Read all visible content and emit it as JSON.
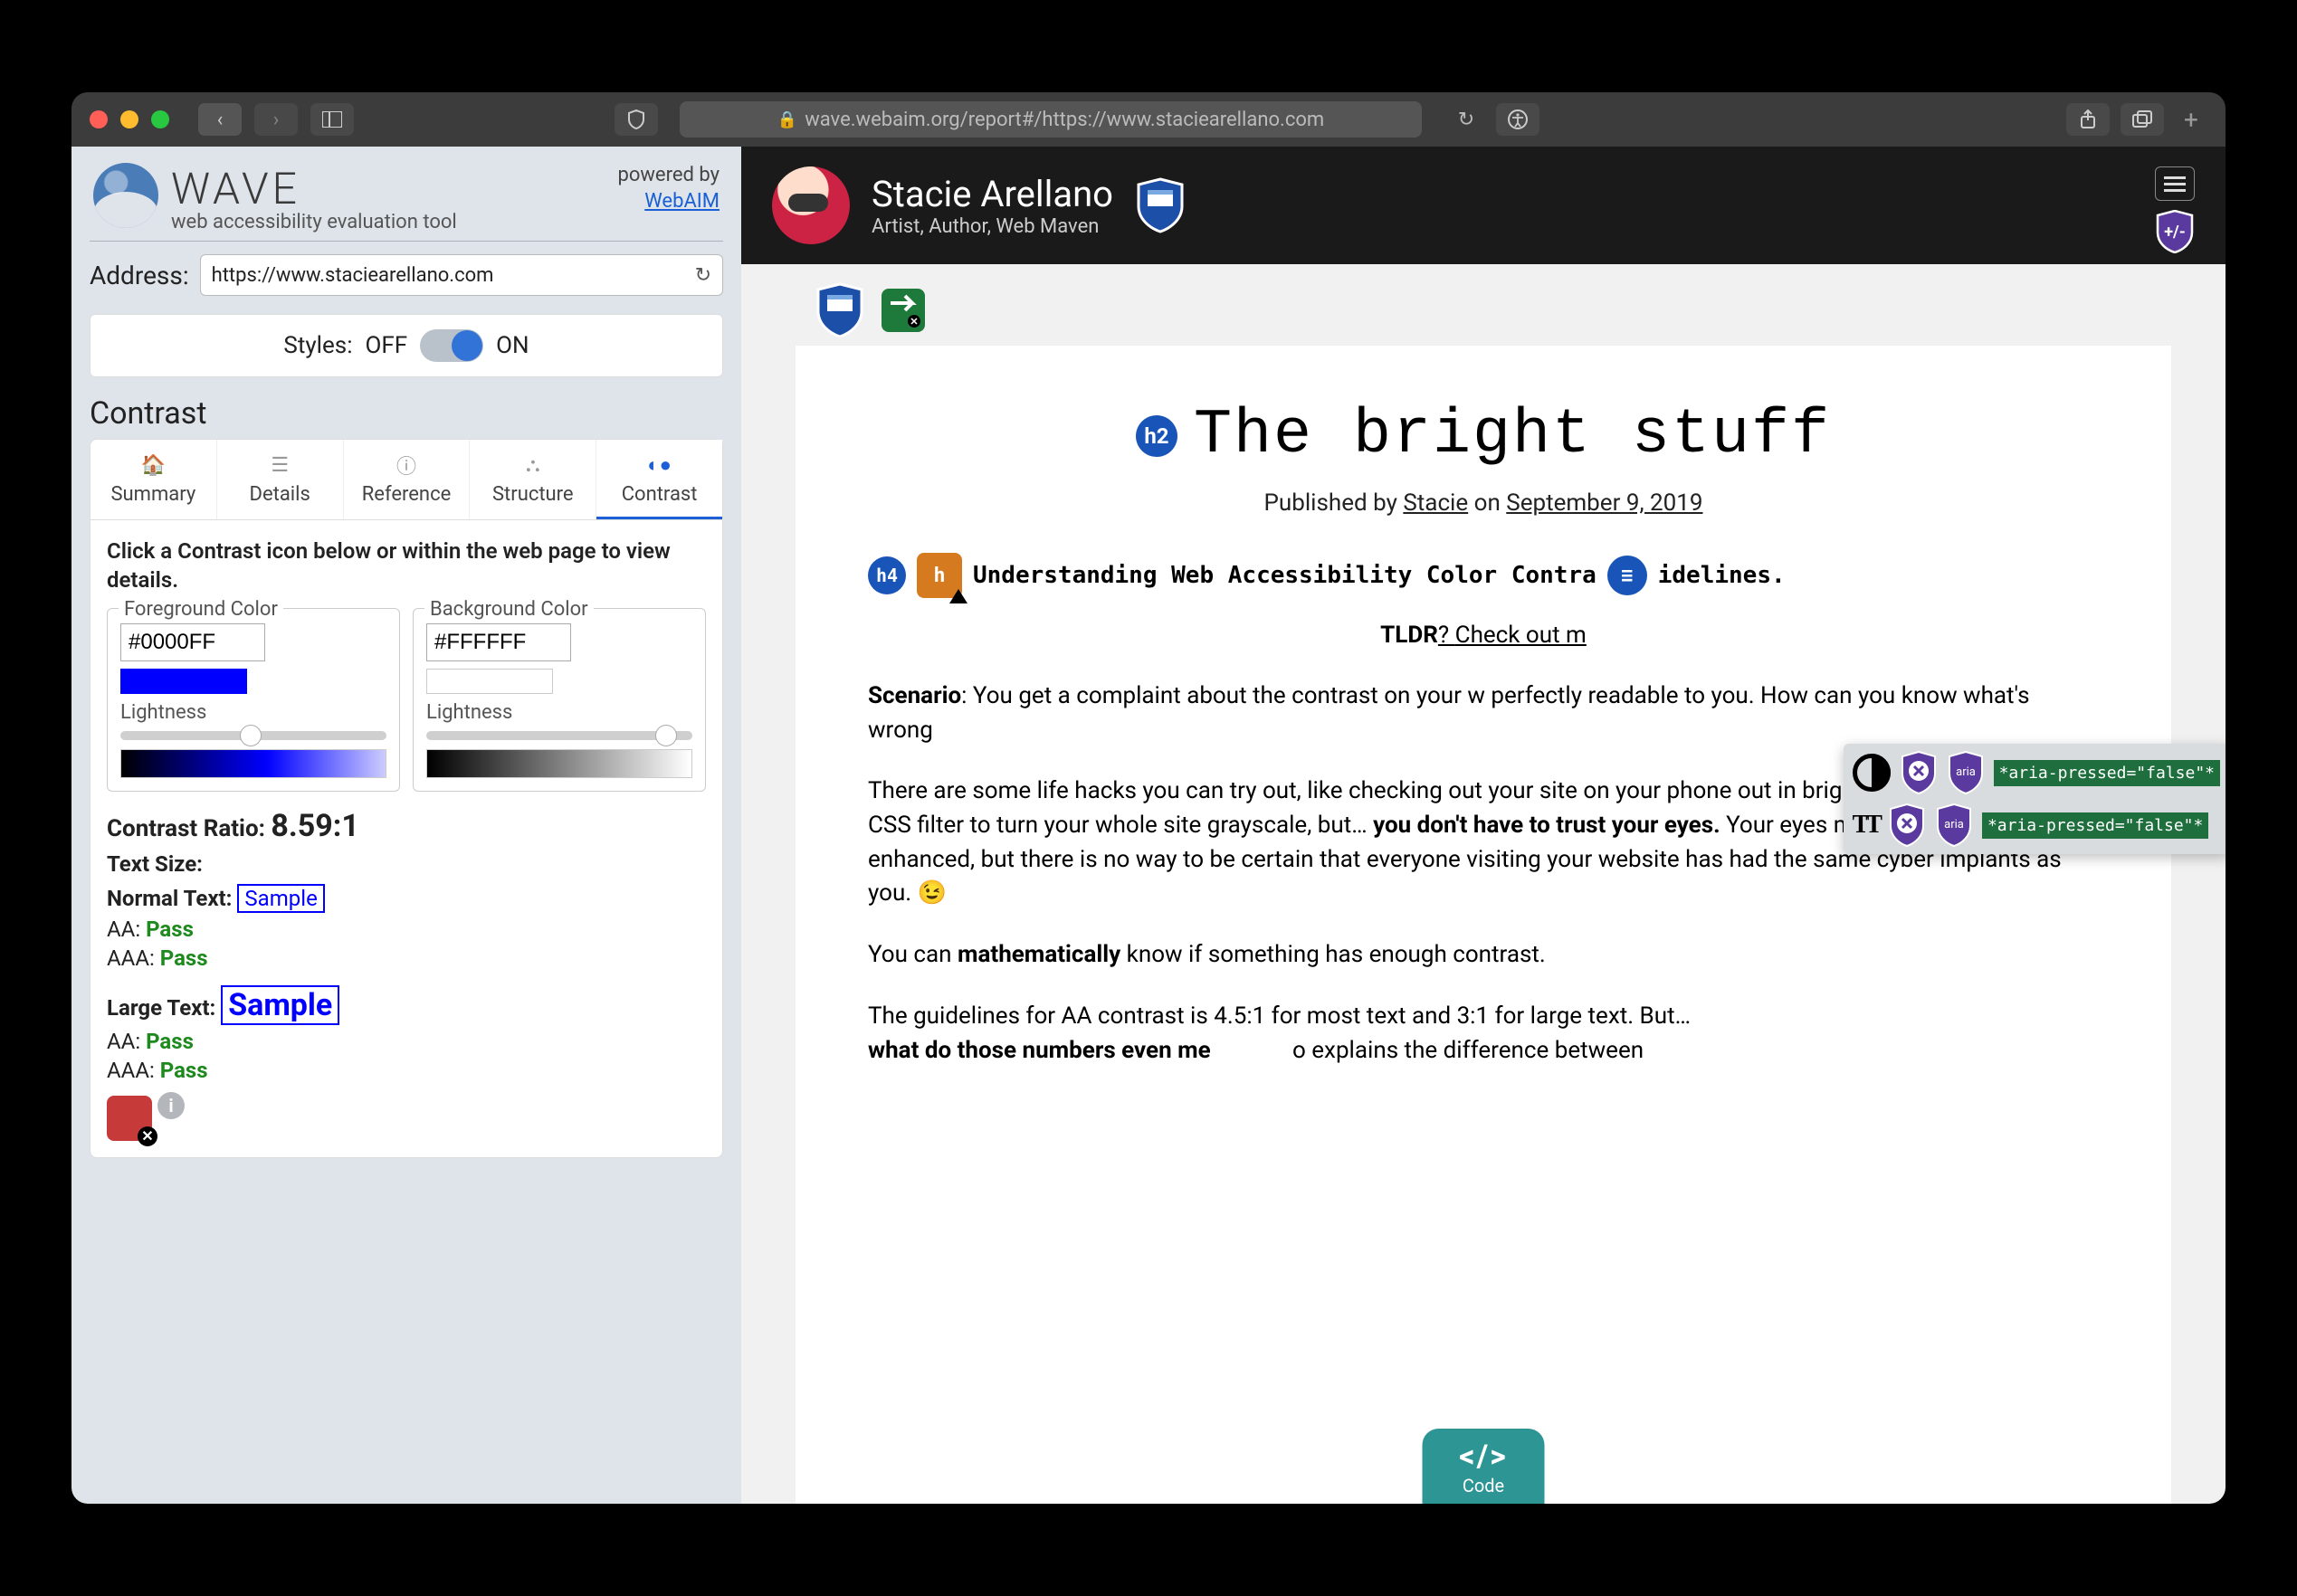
{
  "titlebar": {
    "url_display": "wave.webaim.org/report#/https://www.staciearellano.com"
  },
  "wave": {
    "brand": "WAVE",
    "tagline": "web accessibility evaluation tool",
    "powered_label": "powered by",
    "powered_link": "WebAIM",
    "address_label": "Address:",
    "address_value": "https://www.staciearellano.com",
    "styles_label": "Styles:",
    "styles_off": "OFF",
    "styles_on": "ON",
    "section": "Contrast",
    "tabs": {
      "summary": "Summary",
      "details": "Details",
      "reference": "Reference",
      "structure": "Structure",
      "contrast": "Contrast"
    },
    "instructions": "Click a Contrast icon below or within the web page to view details.",
    "fg_label": "Foreground Color",
    "bg_label": "Background Color",
    "fg_hex": "#0000FF",
    "bg_hex": "#FFFFFF",
    "lightness": "Lightness",
    "ratio_label": "Contrast Ratio:",
    "ratio_value": "8.59:1",
    "textsize_label": "Text Size:",
    "normal_label": "Normal Text:",
    "large_label": "Large Text:",
    "sample": "Sample",
    "aa": "AA:",
    "aaa": "AAA:",
    "pass": "Pass"
  },
  "page": {
    "author_name": "Stacie Arellano",
    "author_sub": "Artist, Author, Web Maven",
    "article_title": "The bright stuff",
    "pub_prefix": "Published by ",
    "pub_author": "Stacie",
    "pub_mid": " on ",
    "pub_date": "September 9, 2019",
    "h4_pre": "Understanding Web Accessibility Color Contra",
    "h4_post": "idelines.",
    "tldr_label": "TLDR",
    "tldr_q": "? ",
    "tldr_link": "Check out m",
    "p1_pre": "Scenario",
    "p1_body": ": You get a complaint about the contrast on your w                              perfectly readable to you. How can you know what's wrong",
    "p2_a": "There are some life hacks you can try out, like checking out your site on your phone out in bright sunlight, or adding a CSS filter to turn your whole site grayscale, but… ",
    "p2_b": "you don't have to trust your eyes.",
    "p2_c": " Your eyes may be bionically enhanced, but there is no way to be certain that everyone visiting your website has had the same cyber implants as you. 😉",
    "p3_a": "You can ",
    "p3_b": "mathematically",
    "p3_c": " know if something has enough contrast.",
    "p4_a": "The guidelines for AA contrast is 4.5:1 for most text and 3:1 for large text. But… ",
    "p4_b": "what do those numbers even me",
    "p4_c": "o explains the difference between",
    "aria_text": "*aria-pressed=\"false\"*",
    "code_label": "Code"
  }
}
